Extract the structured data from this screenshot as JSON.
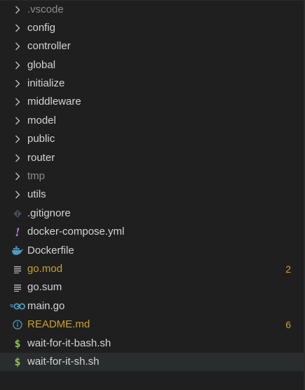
{
  "explorer": {
    "folders": [
      {
        "label": ".vscode",
        "dim": true
      },
      {
        "label": "config",
        "dim": false
      },
      {
        "label": "controller",
        "dim": false
      },
      {
        "label": "global",
        "dim": false
      },
      {
        "label": "initialize",
        "dim": false
      },
      {
        "label": "middleware",
        "dim": false
      },
      {
        "label": "model",
        "dim": false
      },
      {
        "label": "public",
        "dim": false
      },
      {
        "label": "router",
        "dim": false
      },
      {
        "label": "tmp",
        "dim": true
      },
      {
        "label": "utils",
        "dim": false
      }
    ],
    "files": [
      {
        "label": ".gitignore",
        "icon": "git-icon"
      },
      {
        "label": "docker-compose.yml",
        "icon": "exclamation-icon"
      },
      {
        "label": "Dockerfile",
        "icon": "docker-whale-icon"
      },
      {
        "label": "go.mod",
        "icon": "lines-icon",
        "badge": "2",
        "modified": true
      },
      {
        "label": "go.sum",
        "icon": "lines-icon"
      },
      {
        "label": "main.go",
        "icon": "go-icon"
      },
      {
        "label": "README.md",
        "icon": "info-icon",
        "badge": "6",
        "modified": true
      },
      {
        "label": "wait-for-it-bash.sh",
        "icon": "dollar-icon"
      },
      {
        "label": "wait-for-it-sh.sh",
        "icon": "dollar-icon",
        "selected": true
      }
    ],
    "colors": {
      "background": "#1f1f1f",
      "text": "#d4d4d4",
      "dim_text": "#8c8c8c",
      "modified": "#c9a226",
      "selected_row": "#2a2d2e"
    }
  }
}
